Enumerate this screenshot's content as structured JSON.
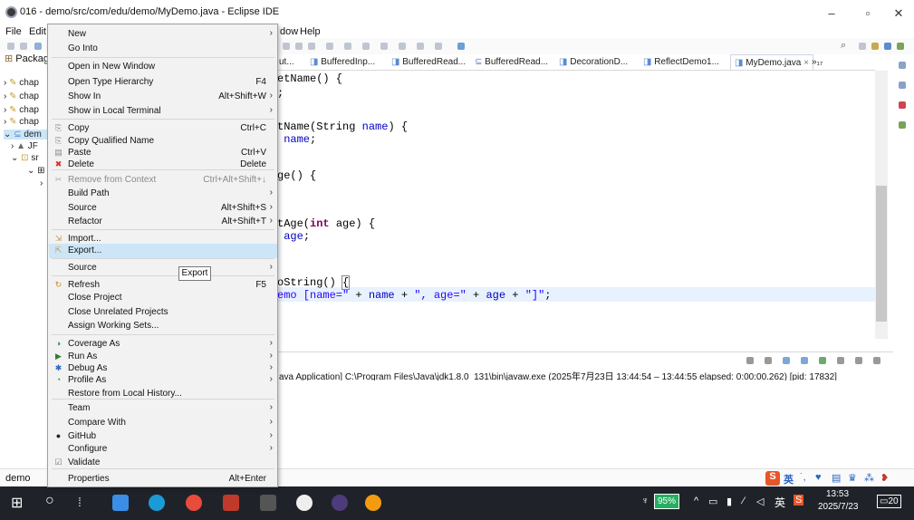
{
  "window": {
    "title": "016 - demo/src/com/edu/demo/MyDemo.java - Eclipse IDE",
    "controls": [
      "–",
      "▫",
      "✕"
    ]
  },
  "menubar": {
    "items": [
      "File",
      "Edit",
      "dow",
      "Help"
    ]
  },
  "package_explorer": {
    "tab_label": "Packag",
    "tree": [
      "chap",
      "chap",
      "chap",
      "chap",
      "dem",
      "JF",
      "sr"
    ]
  },
  "editor": {
    "tabs": [
      "ut...",
      "BufferedInp...",
      "BufferedRead...",
      "BufferedRead...",
      "DecorationD...",
      "ReflectDemo1...",
      "MyDemo.java",
      "»₁₇"
    ],
    "code_lines": {
      "l1": "etName() {",
      "l2": ";",
      "l3a": "tName(String ",
      "l3b": "name",
      "l3c": ") {",
      "l4a": " ",
      "l4b": "name",
      "l4c": ";",
      "l5": "ge() {",
      "l6a": "tAge(",
      "l6b": "int",
      "l6c": " age) {",
      "l7a": " ",
      "l7b": "age",
      "l7c": ";",
      "l8a": "oString() ",
      "l8b": "{",
      "l9a": "emo [name=\"",
      "l9b": " + ",
      "l9c": "name",
      "l9d": " + ",
      "l9e": "\", age=\"",
      "l9f": " + ",
      "l9g": "age",
      "l9h": " + ",
      "l9i": "\"]\"",
      "l9j": ";"
    }
  },
  "console": {
    "line": "ava Application] C:\\Program Files\\Java\\jdk1.8.0_131\\bin\\javaw.exe  (2025年7月23日 13:44:54 – 13:44:55 elapsed: 0:00:00.262) [pid: 17832]"
  },
  "statusbar": {
    "text": "demo"
  },
  "context_menu": {
    "items": [
      {
        "label": "New",
        "shortcut": "",
        "submenu": true
      },
      {
        "label": "Go Into",
        "shortcut": ""
      },
      {
        "label": "Open in New Window",
        "shortcut": ""
      },
      {
        "label": "Open Type Hierarchy",
        "shortcut": "F4"
      },
      {
        "label": "Show In",
        "shortcut": "Alt+Shift+W",
        "submenu": true
      },
      {
        "label": "Show in Local Terminal",
        "shortcut": "",
        "submenu": true
      },
      {
        "label": "Copy",
        "shortcut": "Ctrl+C",
        "icon": "copy-icon"
      },
      {
        "label": "Copy Qualified Name",
        "shortcut": "",
        "icon": "copy-qualified-icon"
      },
      {
        "label": "Paste",
        "shortcut": "Ctrl+V",
        "icon": "paste-icon"
      },
      {
        "label": "Delete",
        "shortcut": "Delete",
        "icon": "delete-icon"
      },
      {
        "label": "Remove from Context",
        "shortcut": "Ctrl+Alt+Shift+↓",
        "disabled": true,
        "icon": "remove-icon"
      },
      {
        "label": "Build Path",
        "shortcut": "",
        "submenu": true
      },
      {
        "label": "Source",
        "shortcut": "Alt+Shift+S",
        "submenu": true
      },
      {
        "label": "Refactor",
        "shortcut": "Alt+Shift+T",
        "submenu": true
      },
      {
        "label": "Import...",
        "shortcut": "",
        "icon": "import-icon"
      },
      {
        "label": "Export...",
        "shortcut": "",
        "icon": "export-icon",
        "highlighted": true
      },
      {
        "label": "Source",
        "shortcut": "",
        "submenu": true
      },
      {
        "label": "Refresh",
        "shortcut": "F5",
        "icon": "refresh-icon"
      },
      {
        "label": "Close Project",
        "shortcut": ""
      },
      {
        "label": "Close Unrelated Projects",
        "shortcut": ""
      },
      {
        "label": "Assign Working Sets...",
        "shortcut": ""
      },
      {
        "label": "Coverage As",
        "shortcut": "",
        "submenu": true,
        "icon": "coverage-icon"
      },
      {
        "label": "Run As",
        "shortcut": "",
        "submenu": true,
        "icon": "run-icon"
      },
      {
        "label": "Debug As",
        "shortcut": "",
        "submenu": true,
        "icon": "debug-icon"
      },
      {
        "label": "Profile As",
        "shortcut": "",
        "submenu": true,
        "icon": "profile-icon"
      },
      {
        "label": "Restore from Local History...",
        "shortcut": ""
      },
      {
        "label": "Team",
        "shortcut": "",
        "submenu": true
      },
      {
        "label": "Compare With",
        "shortcut": "",
        "submenu": true
      },
      {
        "label": "GitHub",
        "shortcut": "",
        "submenu": true,
        "icon": "github-icon"
      },
      {
        "label": "Configure",
        "shortcut": "",
        "submenu": true
      },
      {
        "label": "Validate",
        "shortcut": "",
        "icon": "validate-icon"
      },
      {
        "label": "Properties",
        "shortcut": "Alt+Enter"
      }
    ],
    "tooltip": "Export"
  },
  "taskbar": {
    "battery": "95%",
    "ime_lang": "英",
    "time": "13:53",
    "date": "2025/7/23",
    "notifications": "20"
  },
  "colors": {
    "highlight": "#cde6f7",
    "taskbar": "#1f2329",
    "keyword": "#7f0055",
    "string": "#2a00ff",
    "field": "#0000c0"
  }
}
